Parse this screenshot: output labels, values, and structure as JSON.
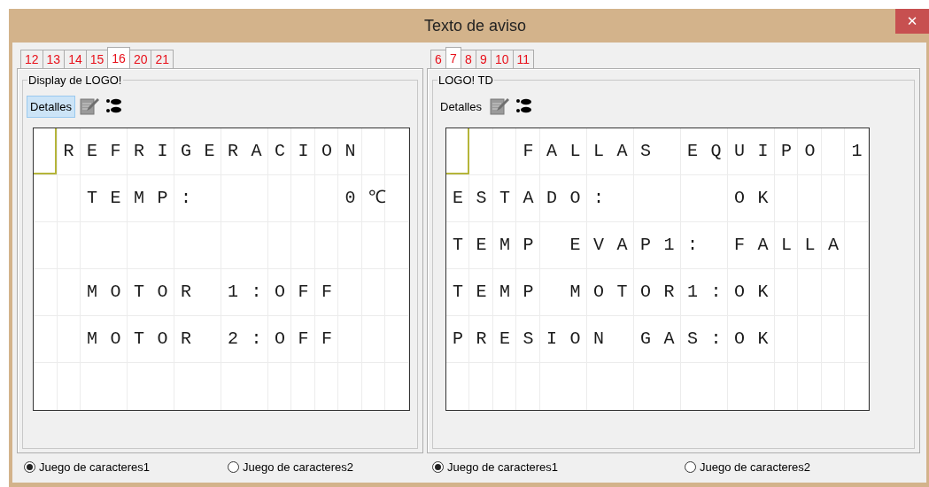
{
  "window": {
    "title": "Texto de aviso",
    "close": "✕"
  },
  "panels": [
    {
      "tabs": [
        {
          "label": "12",
          "selected": false
        },
        {
          "label": "13",
          "selected": false
        },
        {
          "label": "14",
          "selected": false
        },
        {
          "label": "15",
          "selected": false
        },
        {
          "label": "16",
          "selected": true
        },
        {
          "label": "20",
          "selected": false
        },
        {
          "label": "21",
          "selected": false
        }
      ],
      "group_title": "Display de LOGO!",
      "details_button": {
        "label": "Detalles",
        "highlighted": true
      },
      "display": {
        "lines": [
          {
            "text": " REFRIGERACION"
          },
          {
            "text": "  TEMP:      0℃"
          },
          {
            "blank": true
          },
          {
            "text": "  MOTOR 1:OFF"
          },
          {
            "text": "  MOTOR 2:OFF"
          },
          {
            "blank": true
          }
        ]
      },
      "charsets": [
        {
          "label": "Juego de caracteres1",
          "selected": true
        },
        {
          "label": "Juego de caracteres2",
          "selected": false
        }
      ]
    },
    {
      "tabs": [
        {
          "label": "6",
          "selected": false
        },
        {
          "label": "7",
          "selected": true
        },
        {
          "label": "8",
          "selected": false
        },
        {
          "label": "9",
          "selected": false
        },
        {
          "label": "10",
          "selected": false
        },
        {
          "label": "11",
          "selected": false
        }
      ],
      "group_title": "LOGO! TD",
      "details_button": {
        "label": "Detalles",
        "highlighted": false
      },
      "display": {
        "lines": [
          {
            "text": "   FALLAS EQUIPO 1"
          },
          {
            "text": "ESTADO:     OK"
          },
          {
            "text": "TEMP EVAP1: FALLA"
          },
          {
            "text": "TEMP MOTOR1:OK"
          },
          {
            "text": "PRESION GAS:OK"
          },
          {
            "blank": true
          }
        ]
      },
      "charsets": [
        {
          "label": "Juego de caracteres1",
          "selected": true
        },
        {
          "label": "Juego de caracteres2",
          "selected": false
        }
      ]
    }
  ]
}
